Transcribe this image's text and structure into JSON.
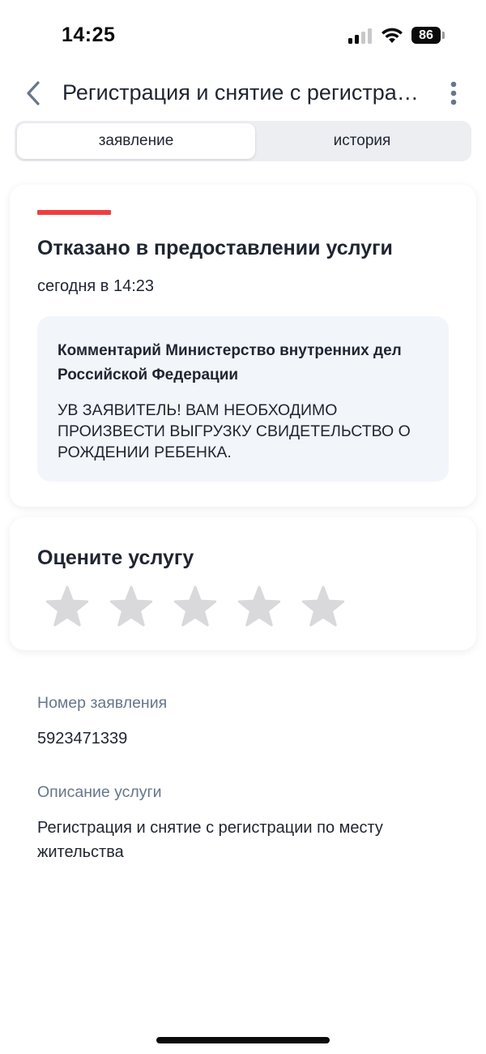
{
  "status_bar": {
    "time": "14:25",
    "battery": "86"
  },
  "header": {
    "title": "Регистрация и снятие с регистрации по месту жительства",
    "back_icon": "chevron-left-icon",
    "more_icon": "more-vertical-icon"
  },
  "tabs": [
    {
      "label": "заявление",
      "active": true
    },
    {
      "label": "история",
      "active": false
    }
  ],
  "status_card": {
    "accent_color": "#ee3f40",
    "title": "Отказано в предоставлении услуги",
    "time": "сегодня в 14:23",
    "comment": {
      "heading": "Комментарий Министерство внутренних дел Российской Федерации",
      "body": "УВ ЗАЯВИТЕЛЬ! ВАМ НЕОБХОДИМО ПРОИЗВЕСТИ ВЫГРУЗКУ СВИДЕТЕЛЬСТВО О РОЖДЕНИИ РЕБЕНКА."
    }
  },
  "rating": {
    "title": "Оцените услугу",
    "max_stars": 5,
    "selected": 0,
    "star_color": "#d9d9dc"
  },
  "info": {
    "number_label": "Номер заявления",
    "number_value": "5923471339",
    "description_label": "Описание услуги",
    "description_value": "Регистрация и снятие с регистрации по месту жительства"
  }
}
